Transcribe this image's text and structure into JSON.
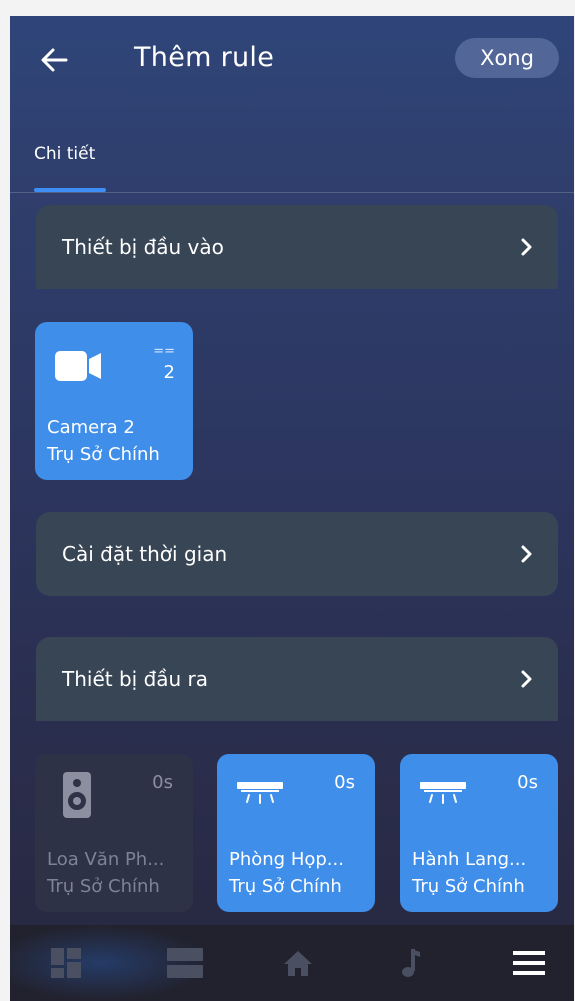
{
  "header": {
    "title": "Thêm rule",
    "done_label": "Xong"
  },
  "tabs": [
    {
      "label": "Chi tiết",
      "active": true
    }
  ],
  "sections": {
    "input": {
      "label": "Thiết bị đầu vào"
    },
    "time": {
      "label": "Cài đặt thời gian"
    },
    "output": {
      "label": "Thiết bị đầu ra"
    }
  },
  "input_devices": [
    {
      "name": "Camera 2",
      "location": "Trụ Sở Chính",
      "icon": "camera-icon",
      "operator": "==",
      "value": "2",
      "active": true
    }
  ],
  "output_devices": [
    {
      "name": "Loa Văn Ph...",
      "location": "Trụ Sở Chính",
      "icon": "speaker-icon",
      "delay": "0s",
      "active": false
    },
    {
      "name": "Phòng Họp...",
      "location": "Trụ Sở Chính",
      "icon": "air-conditioner-icon",
      "delay": "0s",
      "active": true
    },
    {
      "name": "Hành Lang...",
      "location": "Trụ Sở Chính",
      "icon": "air-conditioner-icon",
      "delay": "0s",
      "active": true
    }
  ],
  "bottom_nav": [
    {
      "icon": "dashboard-icon",
      "active": true
    },
    {
      "icon": "rooms-icon",
      "active": false
    },
    {
      "icon": "home-icon",
      "active": false
    },
    {
      "icon": "music-icon",
      "active": false
    },
    {
      "icon": "menu-icon",
      "active": false
    }
  ],
  "colors": {
    "accent": "#3f8eea",
    "row_background": "#384555",
    "tile_inactive": "#2e3246",
    "nav_background": "#22222e"
  }
}
